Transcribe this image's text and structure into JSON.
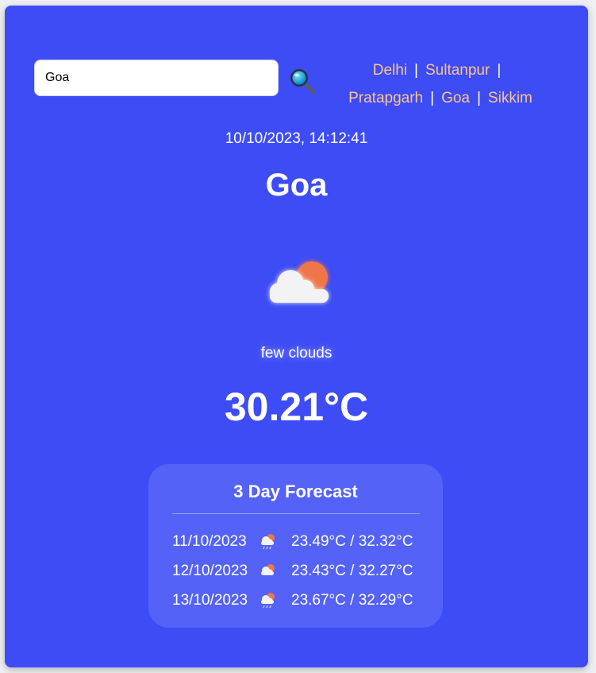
{
  "search": {
    "value": "Goa",
    "button_icon": "search-icon"
  },
  "cities": [
    "Delhi",
    "Sultanpur",
    "Pratapgarh",
    "Goa",
    "Sikkim"
  ],
  "separator": "|",
  "current": {
    "datetime": "10/10/2023, 14:12:41",
    "city": "Goa",
    "icon": "cloud-sun-icon",
    "description": "few clouds",
    "temperature": "30.21°C"
  },
  "forecast": {
    "title": "3 Day Forecast",
    "days": [
      {
        "date": "11/10/2023",
        "icon": "cloud-rain-sun-icon",
        "temps": "23.49°C / 32.32°C"
      },
      {
        "date": "12/10/2023",
        "icon": "cloud-sun-icon",
        "temps": "23.43°C / 32.27°C"
      },
      {
        "date": "13/10/2023",
        "icon": "cloud-rain-sun-icon",
        "temps": "23.67°C / 32.29°C"
      }
    ]
  },
  "colors": {
    "background": "#3d4cf5",
    "panel": "#5462f7",
    "link": "#ffc58e",
    "text": "#ffffff"
  }
}
